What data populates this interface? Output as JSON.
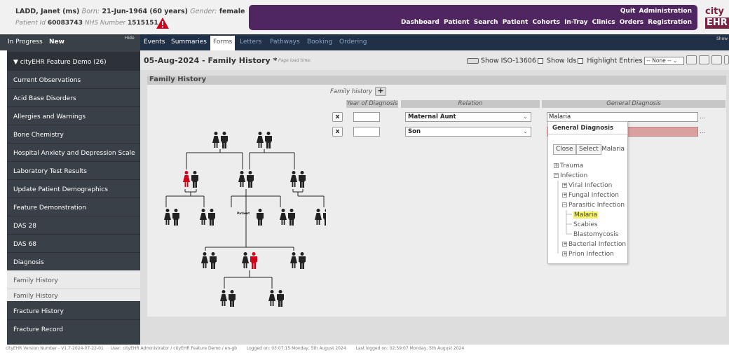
{
  "patient": {
    "name": "LADD, Janet",
    "title": "(ms)",
    "born_label": "Born:",
    "born_date": "21-Jun-1964",
    "age": "(60 years)",
    "gender_label": "Gender:",
    "gender": "female",
    "id_label": "Patient Id",
    "id": "60083743",
    "nhs_label": "NHS Number",
    "nhs": "1515151"
  },
  "header": {
    "top_links": "Quit  Administration",
    "nav_links": "Dashboard  Patient Search  Patient Cohorts  In-Tray  Clinics  Orders  Registration",
    "brand_top": "city",
    "brand_bottom": "EHR"
  },
  "menu": {
    "in_progress": "In Progress",
    "new": "New",
    "hide": "Hide",
    "show": "Show",
    "tabs": [
      "Events",
      "Summaries",
      "Forms",
      "Letters",
      "Pathways",
      "Booking",
      "Ordering"
    ]
  },
  "sidebar": {
    "header": "▼ cityEHR Feature Demo (26)",
    "items": [
      "Current Observations",
      "Acid Base Disorders",
      "Allergies and Warnings",
      "Bone Chemistry",
      "Hospital Anxiety and Depression Scale",
      "Laboratory Test Results",
      "Update Patient Demographics",
      "Feature Demonstration",
      "DAS 28",
      "DAS 68",
      "Diagnosis",
      "Family History",
      "Family History",
      "Fracture History",
      "Fracture Record"
    ]
  },
  "page": {
    "title": "05-Aug-2024 - Family History",
    "star": "*",
    "load_time": "Page load time:",
    "show_iso": "Show ISO-13606",
    "show_ids": "Show Ids",
    "highlight": "Highlight Entries",
    "highlight_value": "-- None --"
  },
  "form": {
    "section_title": "Family History",
    "history_label": "Family history",
    "add_symbol": "+",
    "columns": [
      "Year of Diagnosis",
      "Relation",
      "General Diagnosis"
    ],
    "rows": [
      {
        "delete": "x",
        "year": "",
        "relation": "Maternal Aunt",
        "diagnosis": "Malaria"
      },
      {
        "delete": "x",
        "year": "",
        "relation": "Son",
        "diagnosis": ""
      }
    ],
    "more": "...",
    "patient_label": "Patient"
  },
  "popup": {
    "title": "General Diagnosis",
    "close": "Close",
    "select": "Select",
    "search": "Malaria",
    "tree": [
      {
        "label": "Trauma",
        "level": 0,
        "exp": "+"
      },
      {
        "label": "Infection",
        "level": 0,
        "exp": "−"
      },
      {
        "label": "Viral Infection",
        "level": 1,
        "exp": "+"
      },
      {
        "label": "Fungal Infection",
        "level": 1,
        "exp": "+"
      },
      {
        "label": "Parasitic Infection",
        "level": 1,
        "exp": "−"
      },
      {
        "label": "Malaria",
        "level": 2,
        "exp": ""
      },
      {
        "label": "Scabies",
        "level": 2,
        "exp": ""
      },
      {
        "label": "Blastomycosis",
        "level": 2,
        "exp": ""
      },
      {
        "label": "Bacterial Infection",
        "level": 1,
        "exp": "+"
      },
      {
        "label": "Prion Infection",
        "level": 1,
        "exp": "+"
      }
    ]
  },
  "footer": {
    "version": "cityEHR Version Number - V1.7-2024-07-22-01",
    "user": "User: cityEHR Administrator / cityEHR Feature Demo / en-gb",
    "logged_on": "Logged on: 03:07:15 Monday, 5th August 2024",
    "last_logged": "Last logged on: 02:59:07 Monday, 5th August 2024"
  },
  "colors": {
    "header_purple": "#4f2660",
    "brand": "#7a2244",
    "menu_blue": "#1f3047",
    "sidebar": "#3a4047",
    "affected_red": "#d0021b",
    "error_field": "#d9a0a0",
    "highlight_yellow": "#f2ef6c"
  }
}
